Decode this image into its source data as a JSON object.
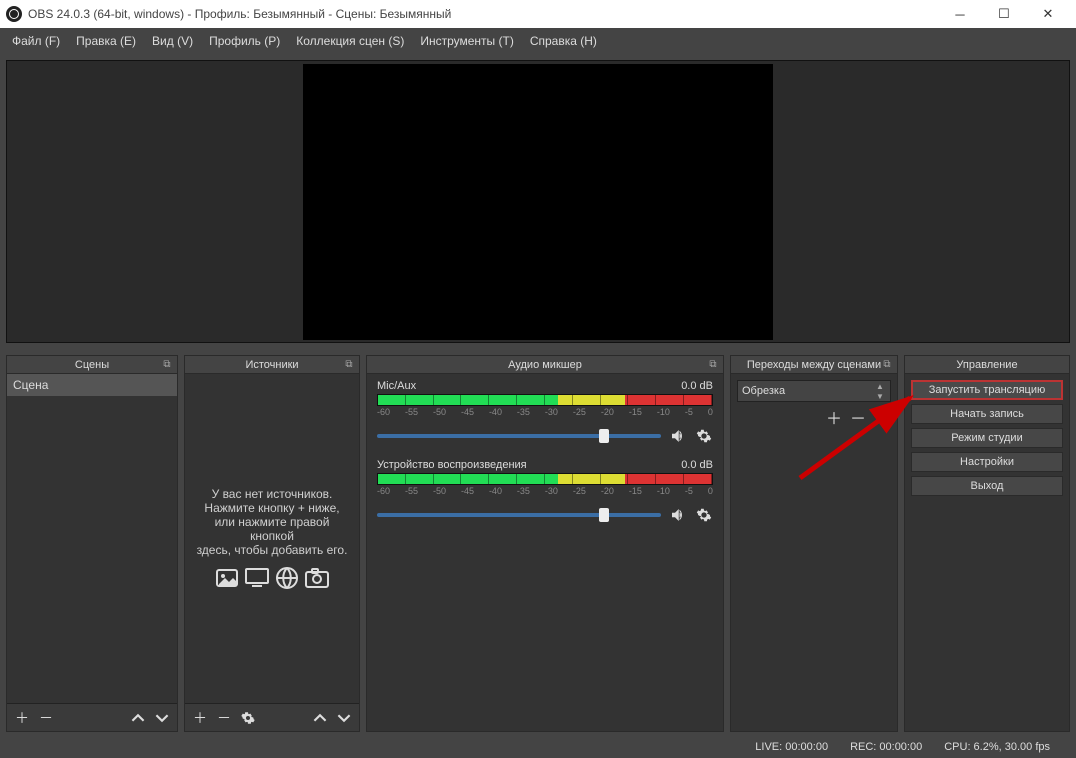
{
  "titlebar": {
    "title": "OBS 24.0.3 (64-bit, windows) - Профиль: Безымянный - Сцены: Безымянный"
  },
  "menu": {
    "file": "Файл (F)",
    "edit": "Правка (E)",
    "view": "Вид (V)",
    "profile": "Профиль (P)",
    "scenecol": "Коллекция сцен (S)",
    "tools": "Инструменты (T)",
    "help": "Справка (H)"
  },
  "docks": {
    "scenes_title": "Сцены",
    "sources_title": "Источники",
    "mixer_title": "Аудио микшер",
    "transitions_title": "Переходы между сценами",
    "controls_title": "Управление"
  },
  "scenes": {
    "item0": "Сцена"
  },
  "sources_empty": {
    "line1": "У вас нет источников.",
    "line2": "Нажмите кнопку + ниже,",
    "line3": "или нажмите правой кнопкой",
    "line4": "здесь, чтобы добавить его."
  },
  "mixer": {
    "ch1_name": "Mic/Aux",
    "ch1_db": "0.0 dB",
    "ch2_name": "Устройство воспроизведения",
    "ch2_db": "0.0 dB",
    "scale": {
      "m60": "-60",
      "m55": "-55",
      "m50": "-50",
      "m45": "-45",
      "m40": "-40",
      "m35": "-35",
      "m30": "-30",
      "m25": "-25",
      "m20": "-20",
      "m15": "-15",
      "m10": "-10",
      "m5": "-5",
      "z": "0"
    }
  },
  "transitions": {
    "selected": "Обрезка"
  },
  "controls": {
    "start_stream": "Запустить трансляцию",
    "start_record": "Начать запись",
    "studio_mode": "Режим студии",
    "settings": "Настройки",
    "exit": "Выход"
  },
  "status": {
    "live": "LIVE: 00:00:00",
    "rec": "REC: 00:00:00",
    "cpu": "CPU: 6.2%, 30.00 fps"
  }
}
